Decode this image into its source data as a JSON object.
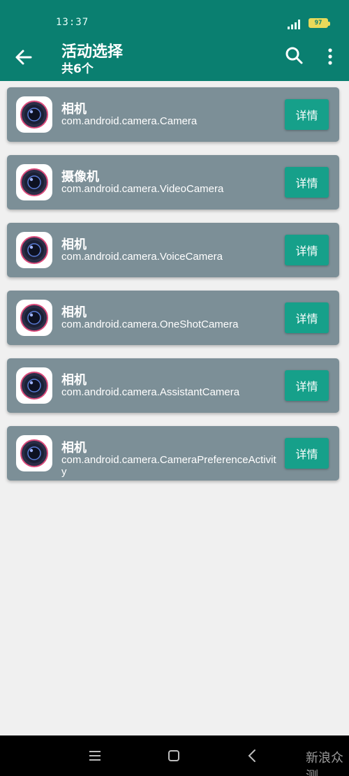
{
  "status": {
    "time": "13:37",
    "battery": "97"
  },
  "header": {
    "title": "活动选择",
    "subtitle": "共6个"
  },
  "items": [
    {
      "name": "相机",
      "package": "com.android.camera.Camera",
      "button": "详情"
    },
    {
      "name": "摄像机",
      "package": "com.android.camera.VideoCamera",
      "button": "详情"
    },
    {
      "name": "相机",
      "package": "com.android.camera.VoiceCamera",
      "button": "详情"
    },
    {
      "name": "相机",
      "package": "com.android.camera.OneShotCamera",
      "button": "详情"
    },
    {
      "name": "相机",
      "package": "com.android.camera.AssistantCamera",
      "button": "详情"
    },
    {
      "name": "相机",
      "package": "com.android.camera.CameraPreferenceActivity",
      "button": "详情"
    }
  ],
  "watermark": "新浪众测",
  "colors": {
    "primary": "#0a7f70",
    "card": "#7c8f97",
    "button": "#16a08a",
    "background": "#f0f0f0"
  },
  "icons": {
    "back": "arrow-left-icon",
    "search": "search-icon",
    "more": "more-vert-icon",
    "app": "camera-icon"
  }
}
